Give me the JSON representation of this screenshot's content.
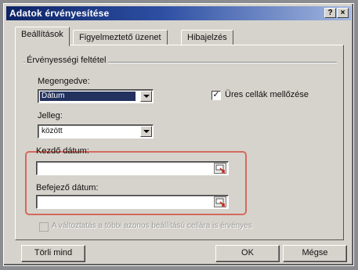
{
  "window": {
    "title": "Adatok érvényesítése",
    "help_btn": "?",
    "close_btn": "×"
  },
  "tabs": [
    {
      "label": "Beállítások",
      "active": true
    },
    {
      "label": "Figyelmeztető üzenet",
      "active": false
    },
    {
      "label": "Hibajelzés",
      "active": false
    }
  ],
  "criteria": {
    "group_label": "Érvényességi feltétel",
    "allow_label": "Megengedve:",
    "allow_value": "Dátum",
    "ignore_blank_label": "Üres cellák mellőzése",
    "ignore_blank_checked": true,
    "data_label": "Jelleg:",
    "data_value": "között",
    "start_label": "Kezdő dátum:",
    "start_value": "",
    "end_label": "Befejező dátum:",
    "end_value": ""
  },
  "apply_all_label": "A változtatás a többi azonos beállítású cellára is érvényes",
  "buttons": {
    "clear_all": "Törli mind",
    "ok": "OK",
    "cancel": "Mégse"
  },
  "colors": {
    "highlight": "#d46a5e",
    "title_dark": "#0d2466",
    "selection": "#22315e"
  }
}
